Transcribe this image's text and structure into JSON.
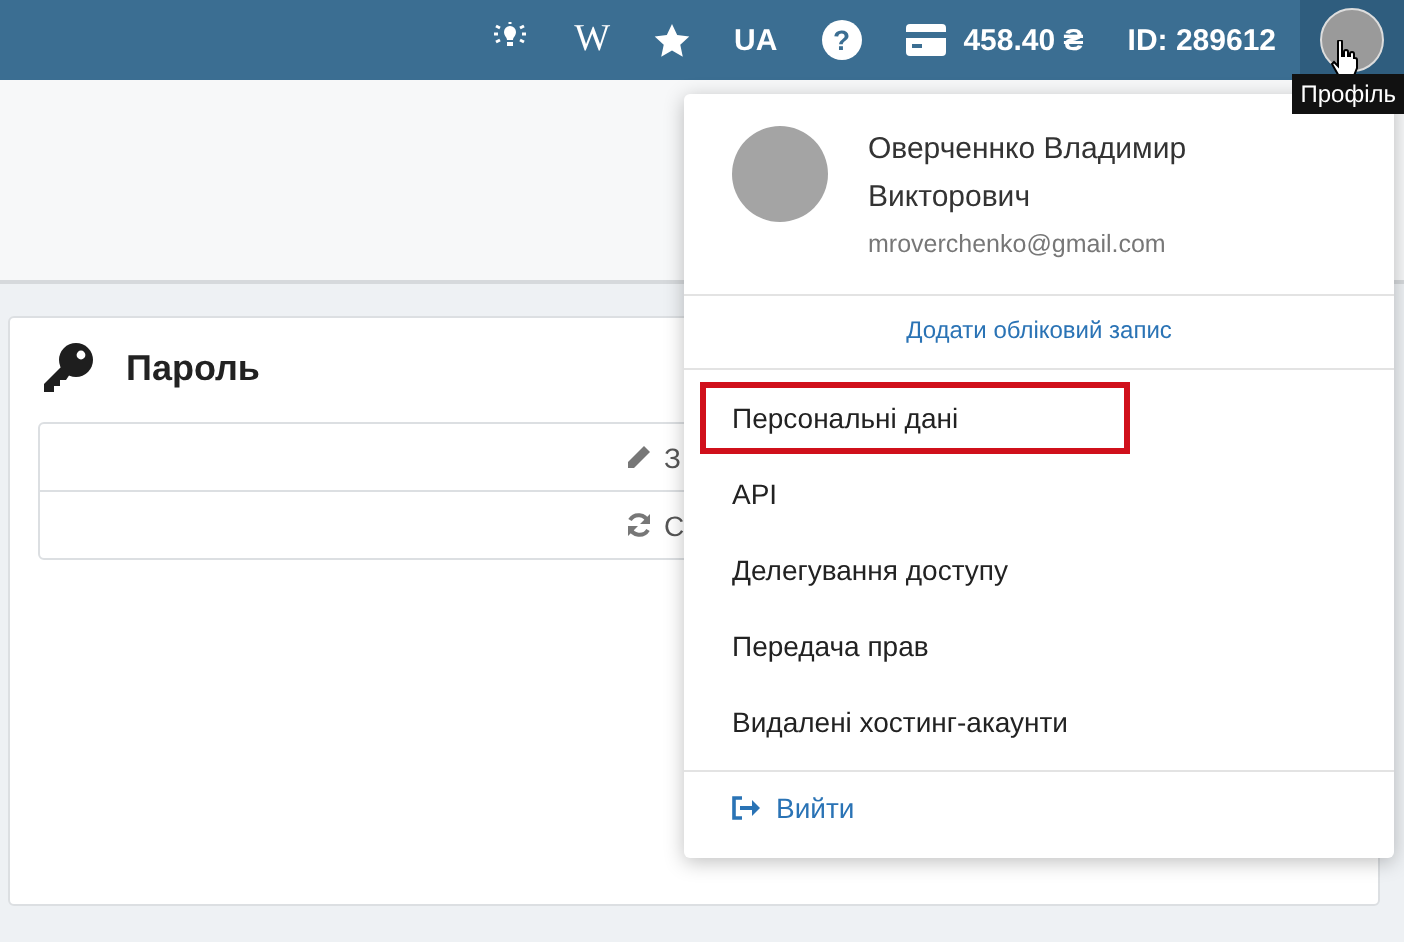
{
  "topbar": {
    "wiki_label": "W",
    "language": "UA",
    "help_label": "?",
    "balance": "458.40 ₴",
    "account_id": "ID: 289612",
    "tooltip": "Профіль"
  },
  "card": {
    "title": "Пароль",
    "rows": [
      {
        "kind": "edit",
        "label": "З"
      },
      {
        "kind": "refresh",
        "label": "С"
      }
    ]
  },
  "profile_menu": {
    "name": "Оверченнко Владимир Викторович",
    "email": "mroverchenko@gmail.com",
    "add_account": "Додати обліковий запис",
    "items": [
      {
        "label": "Персональні дані",
        "highlighted": true
      },
      {
        "label": "API",
        "highlighted": false
      },
      {
        "label": "Делегування доступу",
        "highlighted": false
      },
      {
        "label": "Передача прав",
        "highlighted": false
      },
      {
        "label": "Видалені хостинг-акаунти",
        "highlighted": false
      }
    ],
    "logout": "Вийти"
  }
}
